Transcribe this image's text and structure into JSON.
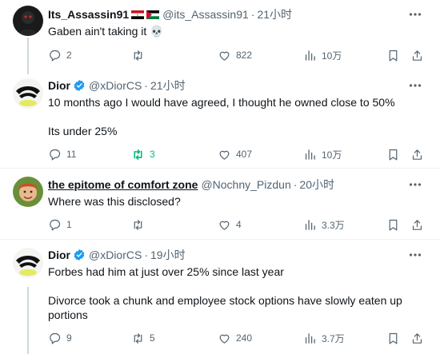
{
  "tweets": [
    {
      "name": "Its_Assassin91",
      "handle": "@its_Assassin91",
      "time": "21小时",
      "lines": [
        "Gaben ain't taking it 💀"
      ],
      "replies": "2",
      "retweets": "",
      "likes": "822",
      "views": "10万"
    },
    {
      "name": "Dior",
      "handle": "@xDiorCS",
      "time": "21小时",
      "lines": [
        "10 months ago I would have agreed, I thought he owned close to 50%",
        "Its under 25%"
      ],
      "replies": "11",
      "retweets": "3",
      "likes": "407",
      "views": "10万"
    },
    {
      "name": "the epitome of comfort zone",
      "handle": "@Nochny_Pizdun",
      "time": "20小时",
      "lines": [
        "Where was this disclosed?"
      ],
      "replies": "1",
      "retweets": "",
      "likes": "4",
      "views": "3.3万"
    },
    {
      "name": "Dior",
      "handle": "@xDiorCS",
      "time": "19小时",
      "lines": [
        "Forbes had him at just over 25% since last year",
        "Divorce took a chunk and employee stock options have slowly eaten up portions"
      ],
      "replies": "9",
      "retweets": "5",
      "likes": "240",
      "views": "3.7万"
    }
  ],
  "ui": {
    "separator": "·"
  },
  "colors": {
    "text": "#0f1419",
    "muted": "#536471",
    "verified": "#1d9bf0",
    "retweet_active": "#00ba7c",
    "divider": "#eff3f4"
  },
  "icons": [
    "more-icon",
    "reply-icon",
    "retweet-icon",
    "like-icon",
    "views-icon",
    "bookmark-icon",
    "share-icon",
    "verified-badge-icon",
    "egypt-flag-icon",
    "jordan-flag-icon"
  ]
}
